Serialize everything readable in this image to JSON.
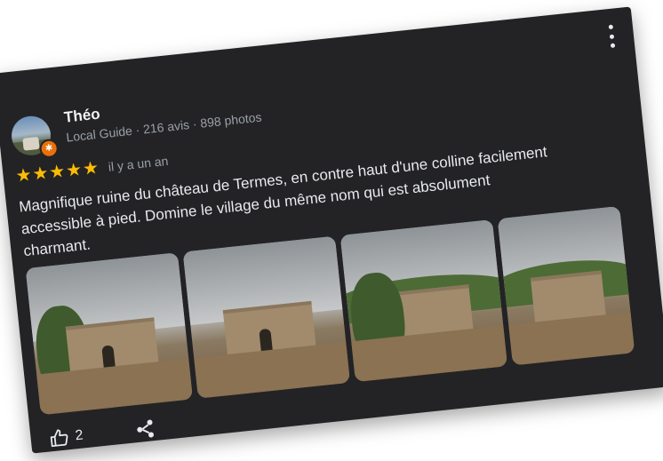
{
  "reviewer": {
    "name": "Théo",
    "meta": "Local Guide · 216 avis · 898 photos"
  },
  "review": {
    "rating": 5,
    "stars": [
      "★",
      "★",
      "★",
      "★",
      "★"
    ],
    "date": "il y a un an",
    "text": "Magnifique ruine du château de Termes, en contre haut d'une colline facilement accessible à pied. Domine le village du même nom qui est absolument charmant."
  },
  "photos": [
    {
      "name": "photo-1"
    },
    {
      "name": "photo-2"
    },
    {
      "name": "photo-3"
    },
    {
      "name": "photo-4"
    }
  ],
  "actions": {
    "like_count": "2",
    "like_icon": "thumb-up-icon",
    "share_icon": "share-icon",
    "more_icon": "more-vertical-icon"
  },
  "colors": {
    "card_background": "#232326",
    "star": "#fbbc04",
    "local_guide_badge": "#e8710a",
    "text_primary": "#e8eaed",
    "text_secondary": "#9aa0a6"
  }
}
